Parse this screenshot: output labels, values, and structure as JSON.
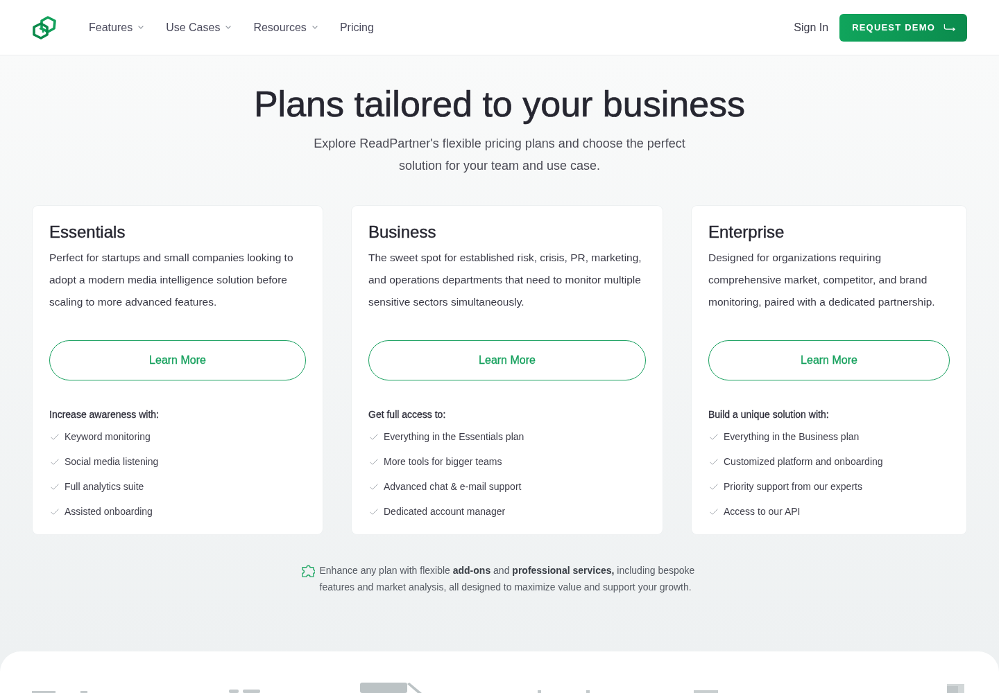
{
  "nav": {
    "items": [
      {
        "label": "Features",
        "kind": "dropdown"
      },
      {
        "label": "Use Cases",
        "kind": "dropdown"
      },
      {
        "label": "Resources",
        "kind": "dropdown"
      },
      {
        "label": "Pricing",
        "kind": "link"
      }
    ],
    "sign_in": "Sign In",
    "cta": "REQUEST DEMO"
  },
  "hero": {
    "title": "Plans tailored to your business",
    "subtitle": "Explore ReadPartner's flexible pricing plans and choose the perfect solution for your team and use case."
  },
  "plans": [
    {
      "name": "Essentials",
      "description": "Perfect for startups and small companies looking to adopt a modern media intelligence solution before scaling to more advanced features.",
      "button": "Learn More",
      "features_heading": "Increase awareness with:",
      "features": [
        "Keyword monitoring",
        "Social media listening",
        "Full analytics suite",
        "Assisted onboarding"
      ]
    },
    {
      "name": "Business",
      "description": "The sweet spot for established risk, crisis, PR, marketing, and operations departments that need to monitor multiple sensitive sectors simultaneously.",
      "button": "Learn More",
      "features_heading": "Get full access to:",
      "features": [
        "Everything in the Essentials plan",
        "More tools for bigger teams",
        "Advanced chat & e-mail support",
        "Dedicated account manager"
      ]
    },
    {
      "name": "Enterprise",
      "description": "Designed for organizations requiring comprehensive market, competitor, and brand monitoring, paired with a dedicated partnership.",
      "button": "Learn More",
      "features_heading": "Build a unique solution with:",
      "features": [
        "Everything in the Business plan",
        "Customized platform and onboarding",
        "Priority support from our experts",
        "Access to our API"
      ]
    }
  ],
  "addons_note": "Enhance any plan with flexible **add-ons** and **professional services,** including bespoke features and market analysis, all designed to maximize value and support your growth."
}
